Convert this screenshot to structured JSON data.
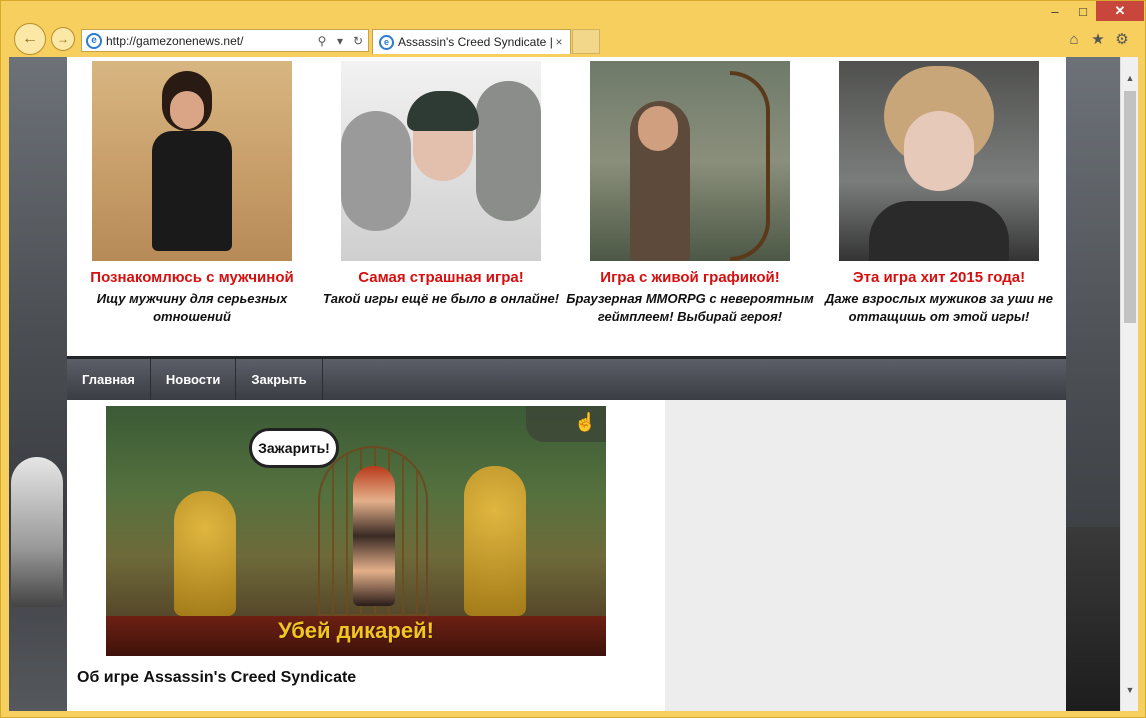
{
  "browser": {
    "url": "http://gamezonenews.net/",
    "tab_title": "Assassin's Creed Syndicate |...",
    "back_icon": "arrow-left-icon",
    "forward_icon": "arrow-right-icon",
    "search_icon": "⚲",
    "dropdown_icon": "▾",
    "refresh_icon": "↻",
    "tab_close": "×",
    "win_min": "–",
    "win_max": "□",
    "win_close": "✕",
    "home_icon": "⌂",
    "star_icon": "★",
    "gear_icon": "⚙",
    "accent_color": "#f6cf5e"
  },
  "promos": [
    {
      "title": "Познакомлюсь с мужчиной",
      "desc": "Ищу мужчину для серьезных отношений"
    },
    {
      "title": "Самая страшная игра!",
      "desc": "Такой игры ещё не было в онлайне!"
    },
    {
      "title": "Игра с живой графикой!",
      "desc": "Браузерная MMORPG с невероятным геймплеем! Выбирай героя!"
    },
    {
      "title": "Эта игра хит 2015 года!",
      "desc": "Даже взрослых мужиков за уши не оттащишь от этой игры!"
    }
  ],
  "nav": {
    "items": [
      "Главная",
      "Новости",
      "Закрыть"
    ]
  },
  "banner": {
    "bubble": "Зажарить!",
    "caption": "Убей дикарей!"
  },
  "article": {
    "title": "Об игре Assassin's Creed Syndicate"
  },
  "scroll": {
    "up": "▲",
    "down": "▼"
  }
}
